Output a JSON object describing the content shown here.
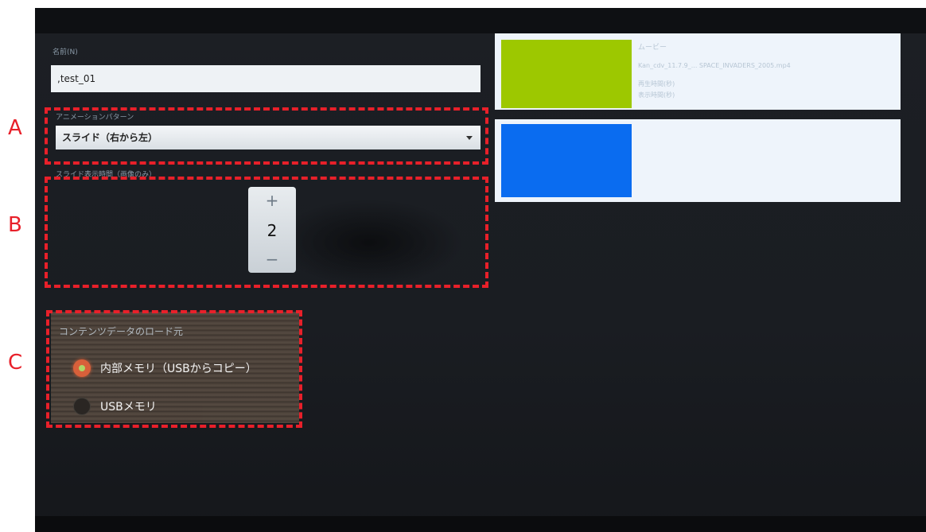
{
  "annotations": {
    "a": "A",
    "b": "B",
    "c": "C"
  },
  "form": {
    "name_label": "名前(N)",
    "name_value": ",test_01",
    "transition_label": "アニメーションパターン",
    "transition_value": "スライド（右から左）",
    "slide_label": "スライド表示時間（画像のみ）",
    "stepper": {
      "plus": "+",
      "value": "2",
      "minus": "−"
    }
  },
  "content_source": {
    "title": "コンテンツデータのロード元",
    "options": [
      {
        "label": "内部メモリ（USBからコピー）",
        "selected": true
      },
      {
        "label": "USBメモリ",
        "selected": false
      }
    ]
  },
  "media_list": [
    {
      "title": "ムービー",
      "file": "Kan_cdv_11.7.9_... SPACE_INVADERS_2005.mp4",
      "line2": "再生時間(秒)",
      "line3": "表示時間(秒)",
      "thumb_color": "#9dc800"
    },
    {
      "title": "",
      "file": "",
      "line2": "",
      "line3": "",
      "thumb_color": "#0a6cf0"
    }
  ],
  "colors": {
    "annotation_red": "#e8202a",
    "screen_bg": "#1a1d22"
  }
}
